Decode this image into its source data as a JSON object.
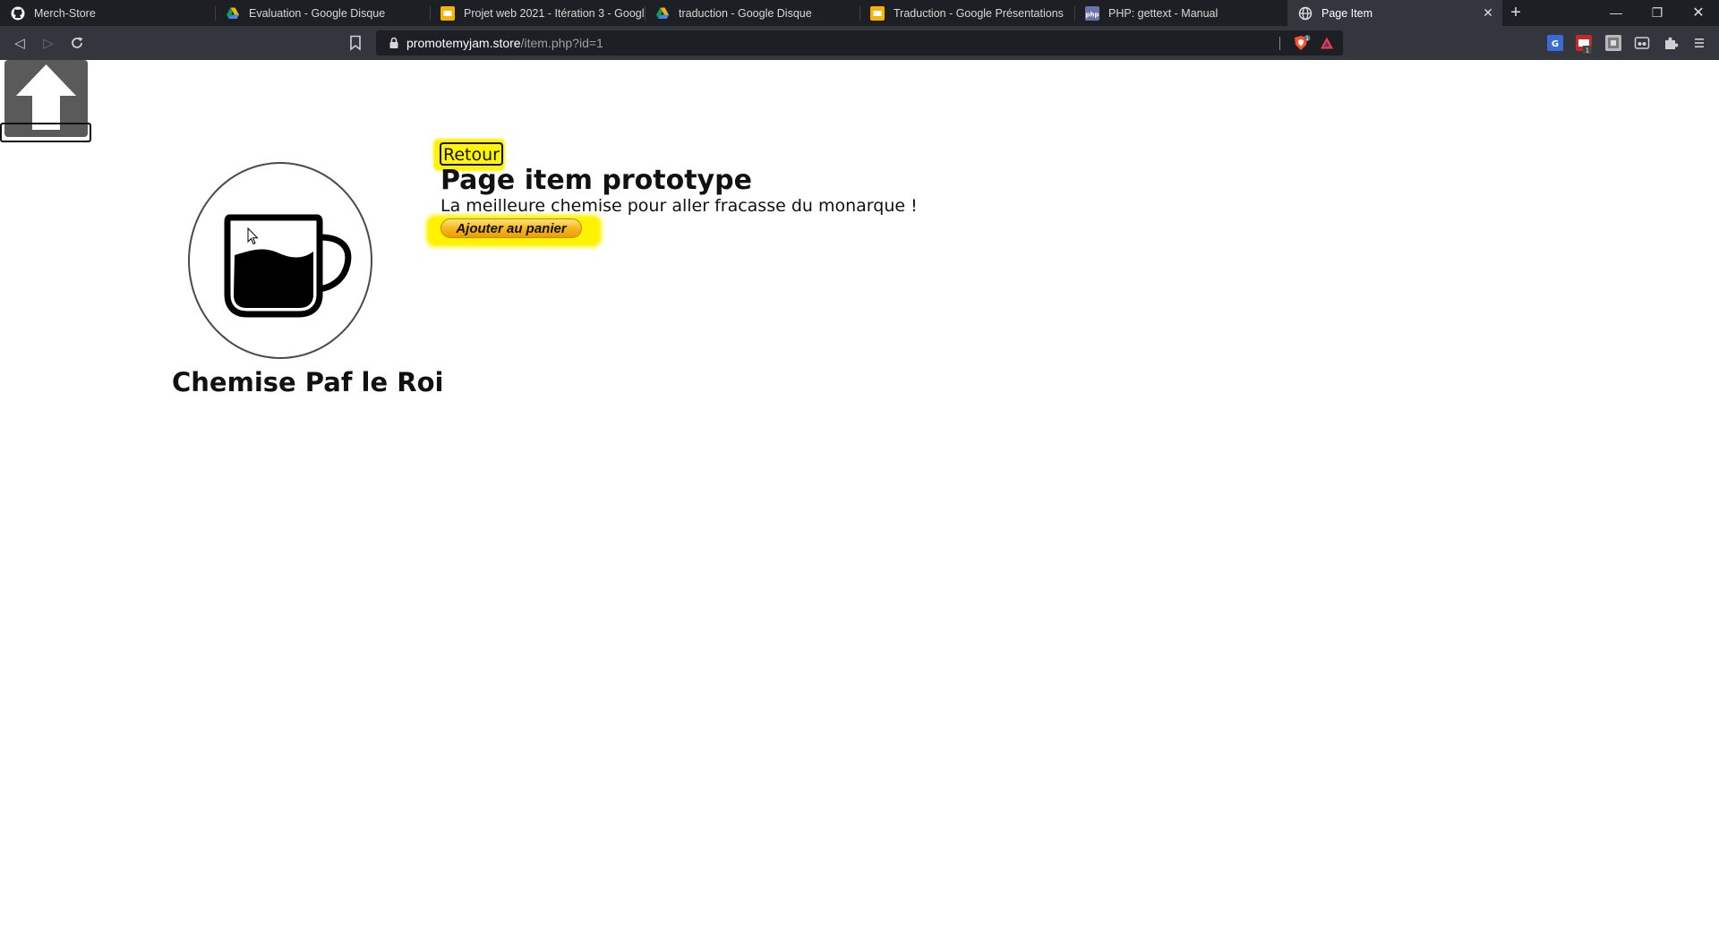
{
  "browser": {
    "tabs": [
      {
        "label": "Merch-Store",
        "icon": "github-icon",
        "active": false
      },
      {
        "label": "Evaluation - Google Disque",
        "icon": "google-drive-icon",
        "active": false
      },
      {
        "label": "Projet web 2021 - Itération 3 - Google",
        "icon": "google-slides-icon",
        "active": false
      },
      {
        "label": "traduction - Google Disque",
        "icon": "google-drive-icon",
        "active": false
      },
      {
        "label": "Traduction - Google Présentations",
        "icon": "google-slides-icon",
        "active": false
      },
      {
        "label": "PHP: gettext - Manual",
        "icon": "php-icon",
        "active": false
      },
      {
        "label": "Page Item",
        "icon": "globe-icon",
        "active": true
      }
    ],
    "url": {
      "host": "promotemyjam.store",
      "path": "/item.php?id=1"
    },
    "brave_badge": "1",
    "extension_badge": "1"
  },
  "page": {
    "back_label": "Retour",
    "heading": "Page item prototype",
    "description": "La meilleure chemise pour aller fracasse du monarque !",
    "add_to_cart_label": "Ajouter au panier",
    "product_name": "Chemise Paf le Roi",
    "product_image_icon": "coffee-cup-icon",
    "scroll_top_icon": "arrow-up-icon"
  },
  "colors": {
    "highlight": "#fff200",
    "tabbar_bg": "#1d1f25",
    "toolbar_bg": "#34363d",
    "cart_button": "#f6b417"
  }
}
